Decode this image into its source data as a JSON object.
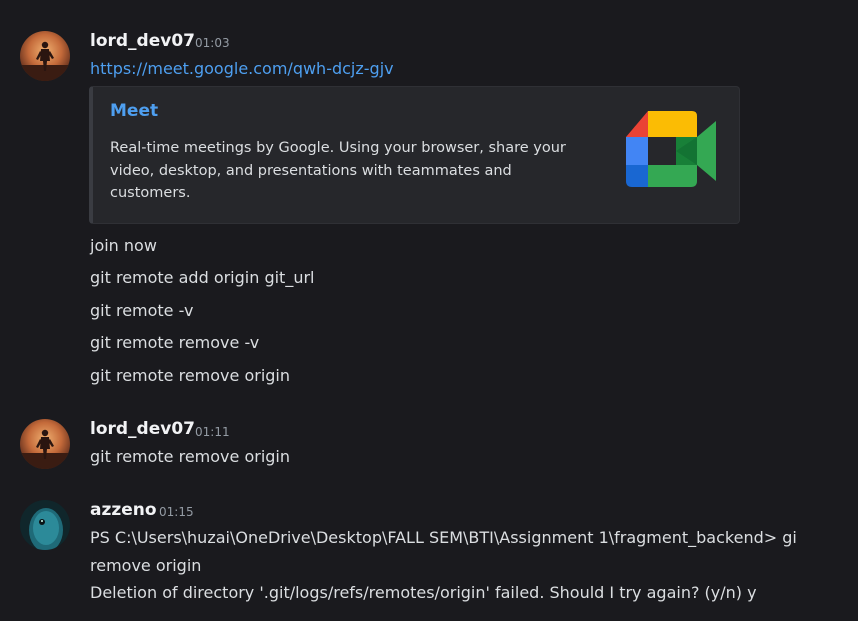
{
  "messages": [
    {
      "username": "lord_dev07",
      "time": "01:03",
      "link": "https://meet.google.com/qwh-dcjz-gjv",
      "embed": {
        "title": "Meet",
        "description": "Real-time meetings by Google. Using your browser, share your video, desktop, and presentations with teammates and customers.",
        "logo_icon": "google-meet-icon"
      },
      "lines": [
        "join now",
        "git remote add origin git_url",
        "git remote -v",
        "git remote remove -v",
        "git remote remove origin"
      ]
    },
    {
      "username": "lord_dev07",
      "time": "01:11",
      "lines": [
        "git remote remove origin"
      ]
    },
    {
      "username": "azzeno",
      "time": "01:15",
      "lines": [
        "PS C:\\Users\\huzai\\OneDrive\\Desktop\\FALL SEM\\BTI\\Assignment 1\\fragment_backend> gi",
        "remove origin",
        "Deletion of directory '.git/logs/refs/remotes/origin' failed. Should I try again? (y/n) y"
      ]
    }
  ],
  "colors": {
    "background": "#1a1a1e",
    "link": "#4e9ff0",
    "username": "#f2f3f5",
    "timestamp": "#949ba4",
    "text": "#dbdee1",
    "embed_bg": "#26272b"
  }
}
